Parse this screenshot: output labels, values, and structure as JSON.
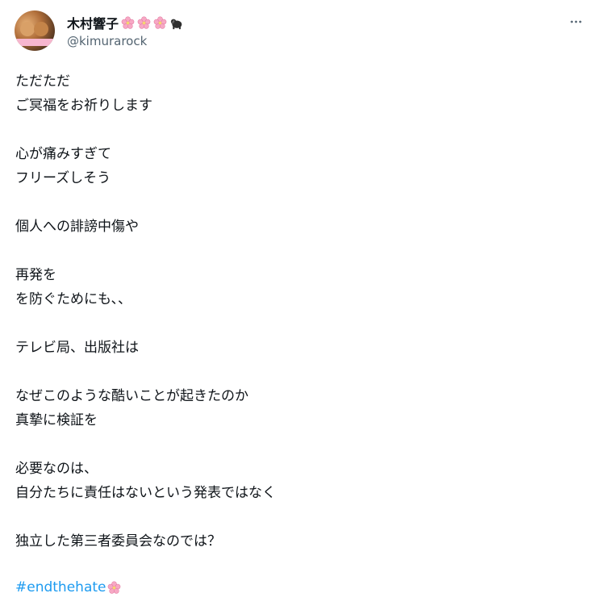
{
  "author": {
    "display_name": "木村響子",
    "handle": "@kimurarock",
    "name_emojis": [
      "cherry-blossom-icon",
      "cherry-blossom-icon",
      "cherry-blossom-icon",
      "gorilla-icon"
    ]
  },
  "tweet": {
    "lines": [
      "ただただ",
      "ご冥福をお祈りします",
      "",
      "心が痛みすぎて",
      "フリーズしそう",
      "",
      "個人への誹謗中傷や",
      "",
      "再発を",
      "を防ぐためにも、、",
      "",
      "テレビ局、出版社は",
      "",
      "なぜこのような酷いことが起きたのか",
      "真摯に検証を",
      "",
      "必要なのは、",
      "自分たちに責任はないという発表ではなく",
      "",
      "独立した第三者委員会なのでは？"
    ],
    "hashtag": "#endthehate",
    "hashtag_emoji": "cherry-blossom-icon"
  },
  "colors": {
    "text": "#0f1419",
    "secondary": "#536471",
    "link": "#1d9bf0",
    "blossom": "#f7a8c4"
  }
}
